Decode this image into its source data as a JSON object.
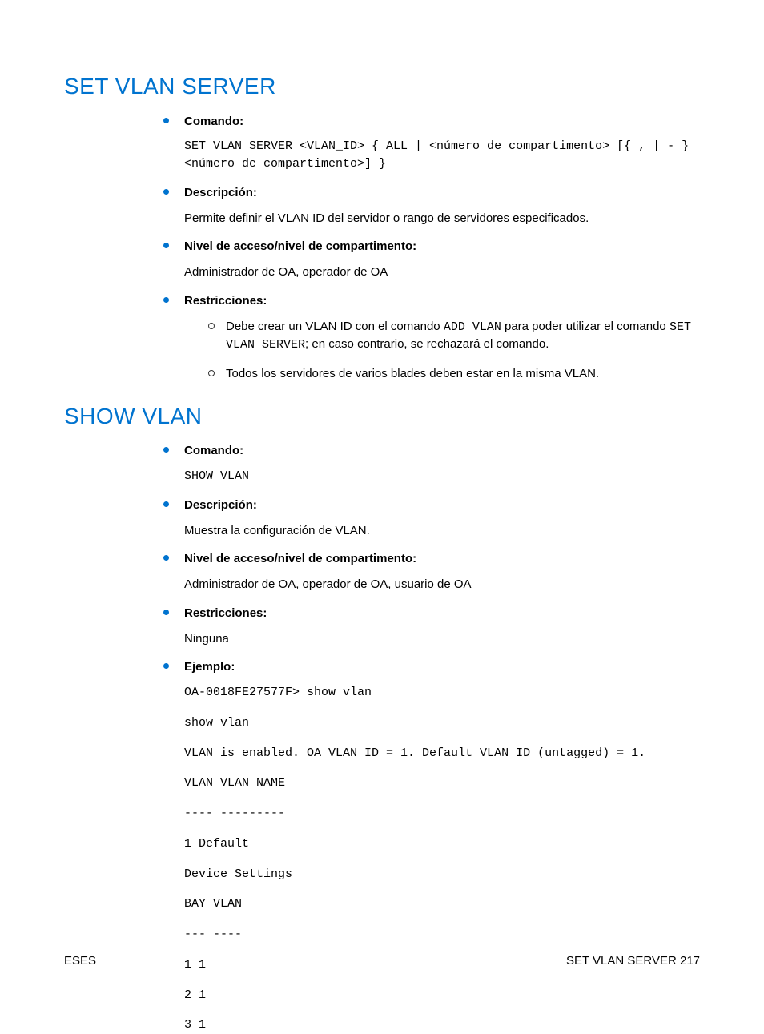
{
  "sections": {
    "set_vlan_server": {
      "heading": "SET VLAN SERVER",
      "items": {
        "comando": {
          "label": "Comando:",
          "code": "SET VLAN SERVER <VLAN_ID> { ALL | <número de compartimento> [{ , | - } <número de compartimento>] }"
        },
        "descripcion": {
          "label": "Descripción:",
          "text": "Permite definir el VLAN ID del servidor o rango de servidores especificados."
        },
        "nivel": {
          "label": "Nivel de acceso/nivel de compartimento:",
          "text": "Administrador de OA, operador de OA"
        },
        "restricciones": {
          "label": "Restricciones:",
          "sub1_pre": "Debe crear un VLAN ID con el comando ",
          "sub1_code1": "ADD VLAN",
          "sub1_mid": " para poder utilizar el comando ",
          "sub1_code2": "SET VLAN SERVER",
          "sub1_post": "; en caso contrario, se rechazará el comando.",
          "sub2": "Todos los servidores de varios blades deben estar en la misma VLAN."
        }
      }
    },
    "show_vlan": {
      "heading": "SHOW VLAN",
      "items": {
        "comando": {
          "label": "Comando:",
          "code": "SHOW VLAN"
        },
        "descripcion": {
          "label": "Descripción:",
          "text": "Muestra la configuración de VLAN."
        },
        "nivel": {
          "label": "Nivel de acceso/nivel de compartimento:",
          "text": "Administrador de OA, operador de OA, usuario de OA"
        },
        "restricciones": {
          "label": "Restricciones:",
          "text": "Ninguna"
        },
        "ejemplo": {
          "label": "Ejemplo:",
          "lines": {
            "l0": "OA-0018FE27577F> show vlan",
            "l1": "show vlan",
            "l2": "VLAN is enabled. OA VLAN ID = 1. Default VLAN ID (untagged) = 1.",
            "l3": "VLAN VLAN NAME",
            "l4": "---- ---------",
            "l5": "1 Default",
            "l6": "Device Settings",
            "l7": "BAY VLAN",
            "l8": "--- ----",
            "l9": "1 1",
            "l10": "2 1",
            "l11": "3 1"
          }
        }
      }
    }
  },
  "footer": {
    "left": "ESES",
    "right": "SET VLAN SERVER  217"
  }
}
